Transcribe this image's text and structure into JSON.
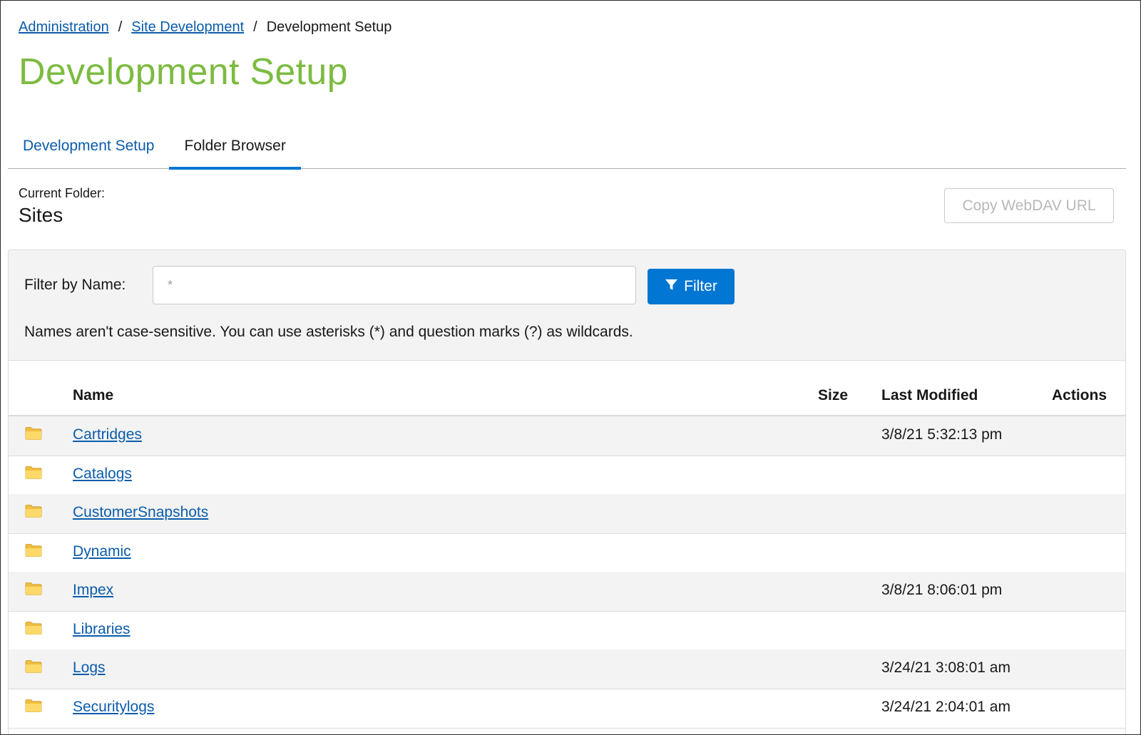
{
  "breadcrumb": {
    "items": [
      {
        "label": "Administration"
      },
      {
        "label": "Site Development"
      },
      {
        "label": "Development Setup"
      }
    ],
    "separator": "/"
  },
  "page": {
    "title": "Development Setup"
  },
  "tabs": [
    {
      "label": "Development Setup",
      "active": false
    },
    {
      "label": "Folder Browser",
      "active": true
    }
  ],
  "current_folder": {
    "label": "Current Folder:",
    "name": "Sites",
    "copy_button": "Copy WebDAV URL"
  },
  "filter": {
    "label": "Filter by Name:",
    "placeholder": "*",
    "value": "",
    "button": "Filter",
    "help": "Names aren't case-sensitive. You can use asterisks (*) and question marks (?) as wildcards."
  },
  "table": {
    "columns": {
      "name": "Name",
      "size": "Size",
      "modified": "Last Modified",
      "actions": "Actions"
    },
    "rows": [
      {
        "name": "Cartridges",
        "size": "",
        "modified": "3/8/21 5:32:13 pm"
      },
      {
        "name": "Catalogs",
        "size": "",
        "modified": ""
      },
      {
        "name": "CustomerSnapshots",
        "size": "",
        "modified": ""
      },
      {
        "name": "Dynamic",
        "size": "",
        "modified": ""
      },
      {
        "name": "Impex",
        "size": "",
        "modified": "3/8/21 8:06:01 pm"
      },
      {
        "name": "Libraries",
        "size": "",
        "modified": ""
      },
      {
        "name": "Logs",
        "size": "",
        "modified": "3/24/21 3:08:01 am"
      },
      {
        "name": "Securitylogs",
        "size": "",
        "modified": "3/24/21 2:04:01 am"
      }
    ]
  },
  "colors": {
    "title": "#7dbb41",
    "link": "#0b5cab",
    "accent": "#0176d3",
    "folder": "#f5c84c"
  },
  "icons": {
    "row": "folder-icon",
    "filter": "funnel-icon"
  }
}
